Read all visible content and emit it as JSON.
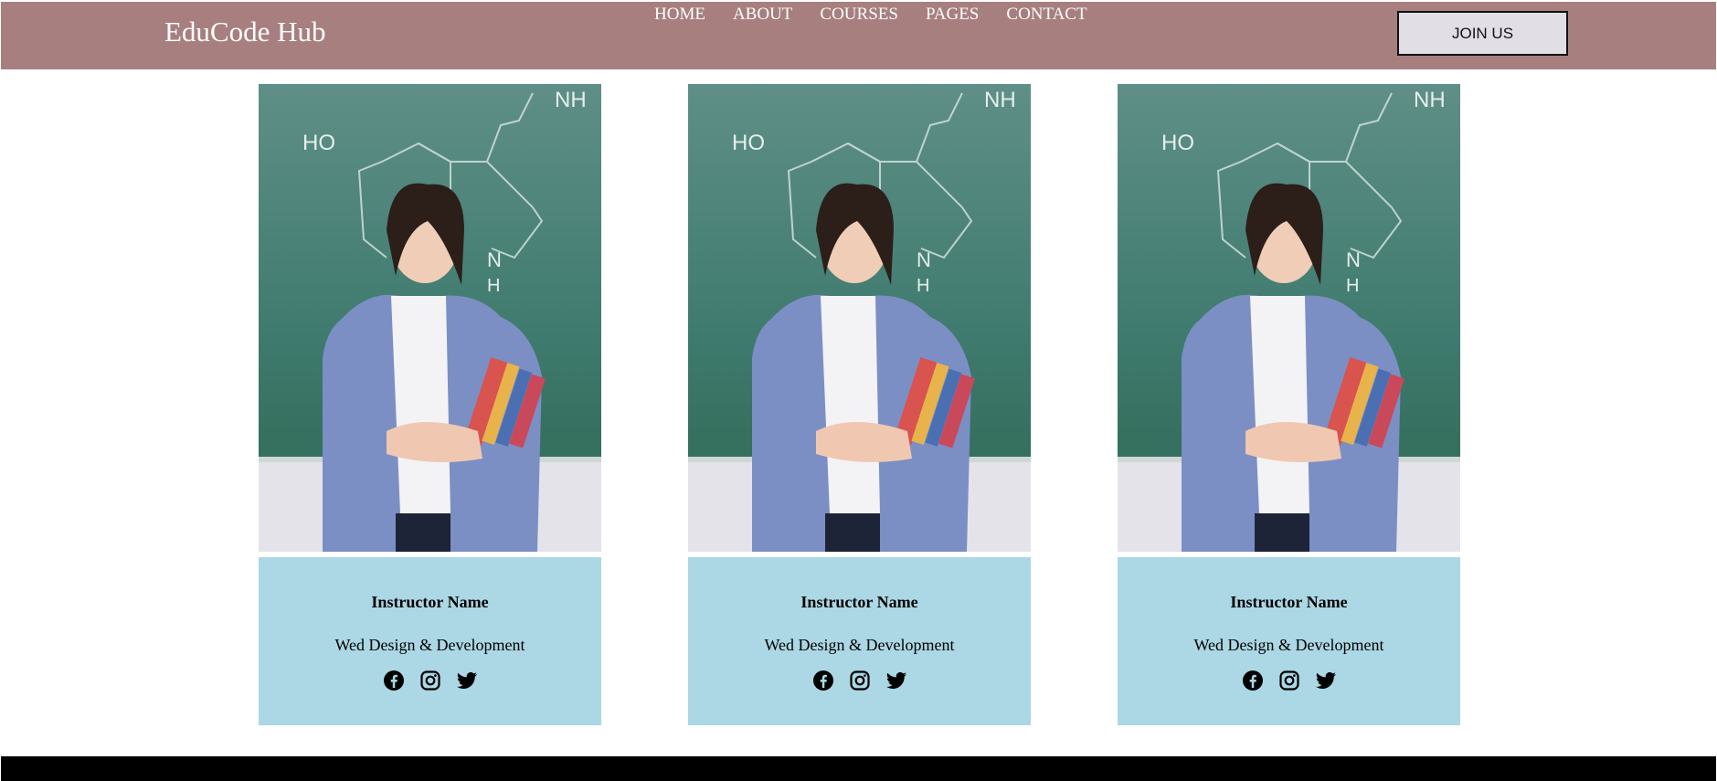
{
  "header": {
    "brand": "EduCode Hub",
    "nav": [
      "HOME",
      "ABOUT",
      "COURSES",
      "PAGES",
      "CONTACT"
    ],
    "join_label": "JOIN US"
  },
  "instructors": [
    {
      "name": "Instructor Name",
      "role": "Wed Design & Development",
      "socials": [
        "facebook-icon",
        "instagram-icon",
        "twitter-icon"
      ]
    },
    {
      "name": "Instructor Name",
      "role": "Wed Design & Development",
      "socials": [
        "facebook-icon",
        "instagram-icon",
        "twitter-icon"
      ]
    },
    {
      "name": "Instructor Name",
      "role": "Wed Design & Development",
      "socials": [
        "facebook-icon",
        "instagram-icon",
        "twitter-icon"
      ]
    }
  ],
  "colors": {
    "header_bg": "#a87f7f",
    "card_info_bg": "#acd7e4",
    "button_bg": "#e1dee6",
    "footer_bg": "#000000"
  }
}
